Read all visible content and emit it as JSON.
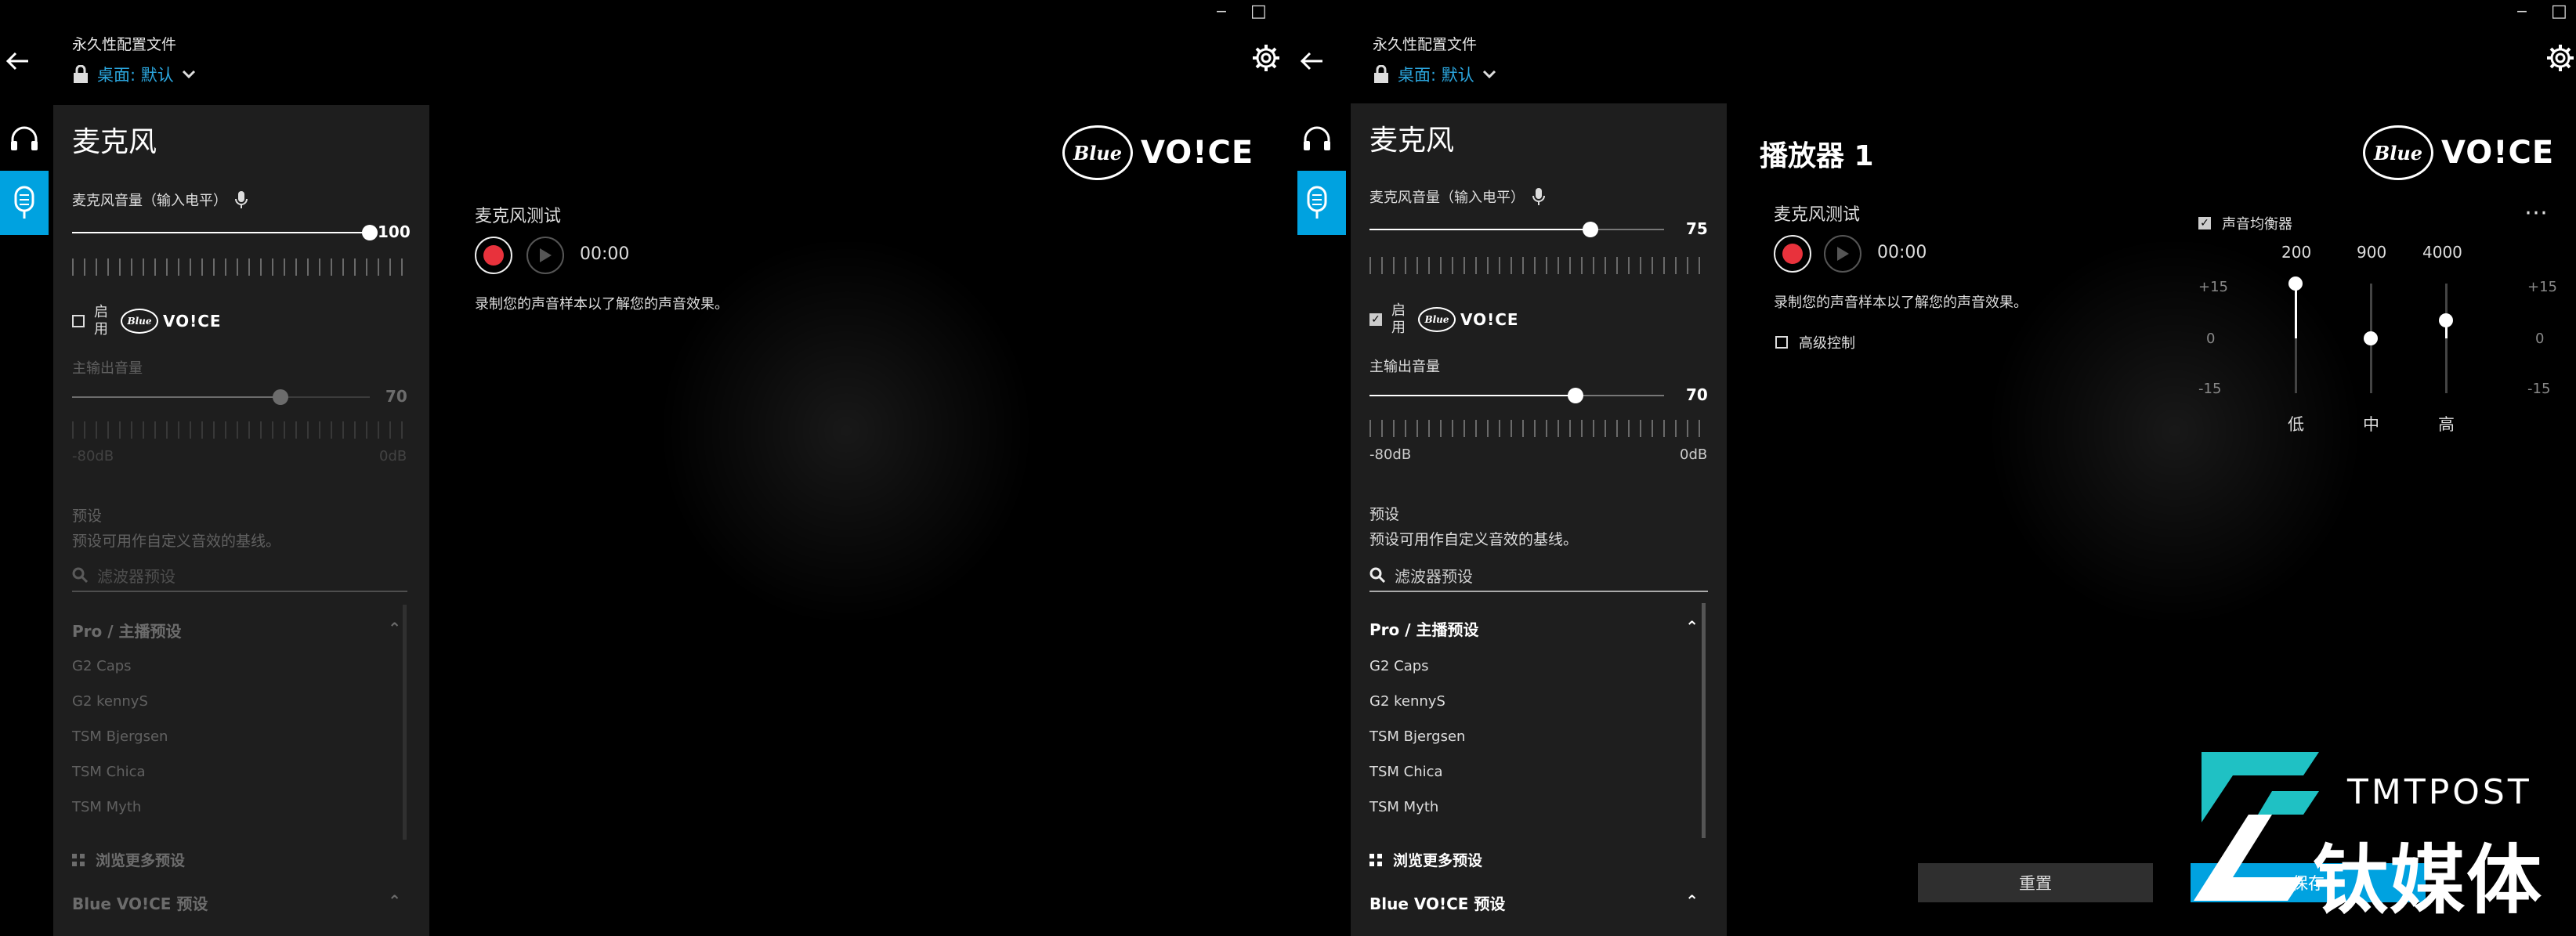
{
  "colors": {
    "accent": "#00a2e0",
    "profile_blue": "#2ba6de",
    "record_red": "#e8323c",
    "panel_bg": "#1e1e1e"
  },
  "window": {
    "minimize_icon": "minimize-icon",
    "maximize_icon": "maximize-icon"
  },
  "left": {
    "header": {
      "profile_label": "永久性配置文件",
      "profile_name": "桌面: 默认"
    },
    "panel": {
      "title": "麦克风",
      "mic_volume_label": "麦克风音量（输入电平）",
      "mic_volume": "100",
      "mic_volume_pct": 100,
      "enable_text": "启用",
      "enabled": false,
      "main_output_label": "主输出音量",
      "main_output": "70",
      "main_output_pct": 70,
      "scale_min": "-80dB",
      "scale_max": "0dB",
      "presets_label": "预设",
      "presets_desc": "预设可用作自定义音效的基线。",
      "search_placeholder": "滤波器预设",
      "group1": "Pro / 主播预设",
      "presets": [
        "G2 Caps",
        "G2 kennyS",
        "TSM Bjergsen",
        "TSM Chica",
        "TSM Myth"
      ],
      "browse_more": "浏览更多预设",
      "group2": "Blue VO!CE 预设"
    },
    "main": {
      "mic_test_label": "麦克风测试",
      "timer": "00:00",
      "hint": "录制您的声音样本以了解您的声音效果。"
    }
  },
  "right": {
    "header": {
      "profile_label": "永久性配置文件",
      "profile_name": "桌面: 默认"
    },
    "panel": {
      "title": "麦克风",
      "mic_volume_label": "麦克风音量（输入电平）",
      "mic_volume": "75",
      "mic_volume_pct": 75,
      "enable_text": "启用",
      "enabled": true,
      "main_output_label": "主输出音量",
      "main_output": "70",
      "main_output_pct": 70,
      "scale_min": "-80dB",
      "scale_max": "0dB",
      "presets_label": "预设",
      "presets_desc": "预设可用作自定义音效的基线。",
      "search_placeholder": "滤波器预设",
      "group1": "Pro / 主播预设",
      "presets": [
        "G2 Caps",
        "G2 kennyS",
        "TSM Bjergsen",
        "TSM Chica",
        "TSM Myth"
      ],
      "browse_more": "浏览更多预设",
      "group2": "Blue VO!CE 预设"
    },
    "main": {
      "title": "播放器 1",
      "mic_test_label": "麦克风测试",
      "timer": "00:00",
      "hint": "录制您的声音样本以了解您的声音效果。",
      "advanced": "高级控制",
      "eq": {
        "title": "声音均衡器",
        "enabled": true,
        "freqs": [
          "200",
          "900",
          "4000"
        ],
        "bands": [
          "低",
          "中",
          "高"
        ],
        "scale": [
          "+15",
          "0",
          "-15"
        ],
        "gains": [
          15,
          0,
          5
        ]
      },
      "reset": "重置",
      "save": "保存"
    }
  },
  "logo": {
    "blue": "Blue",
    "voice": "VO!CE"
  },
  "watermark": {
    "en": "TMTPOST",
    "cn": "钛媒体"
  }
}
